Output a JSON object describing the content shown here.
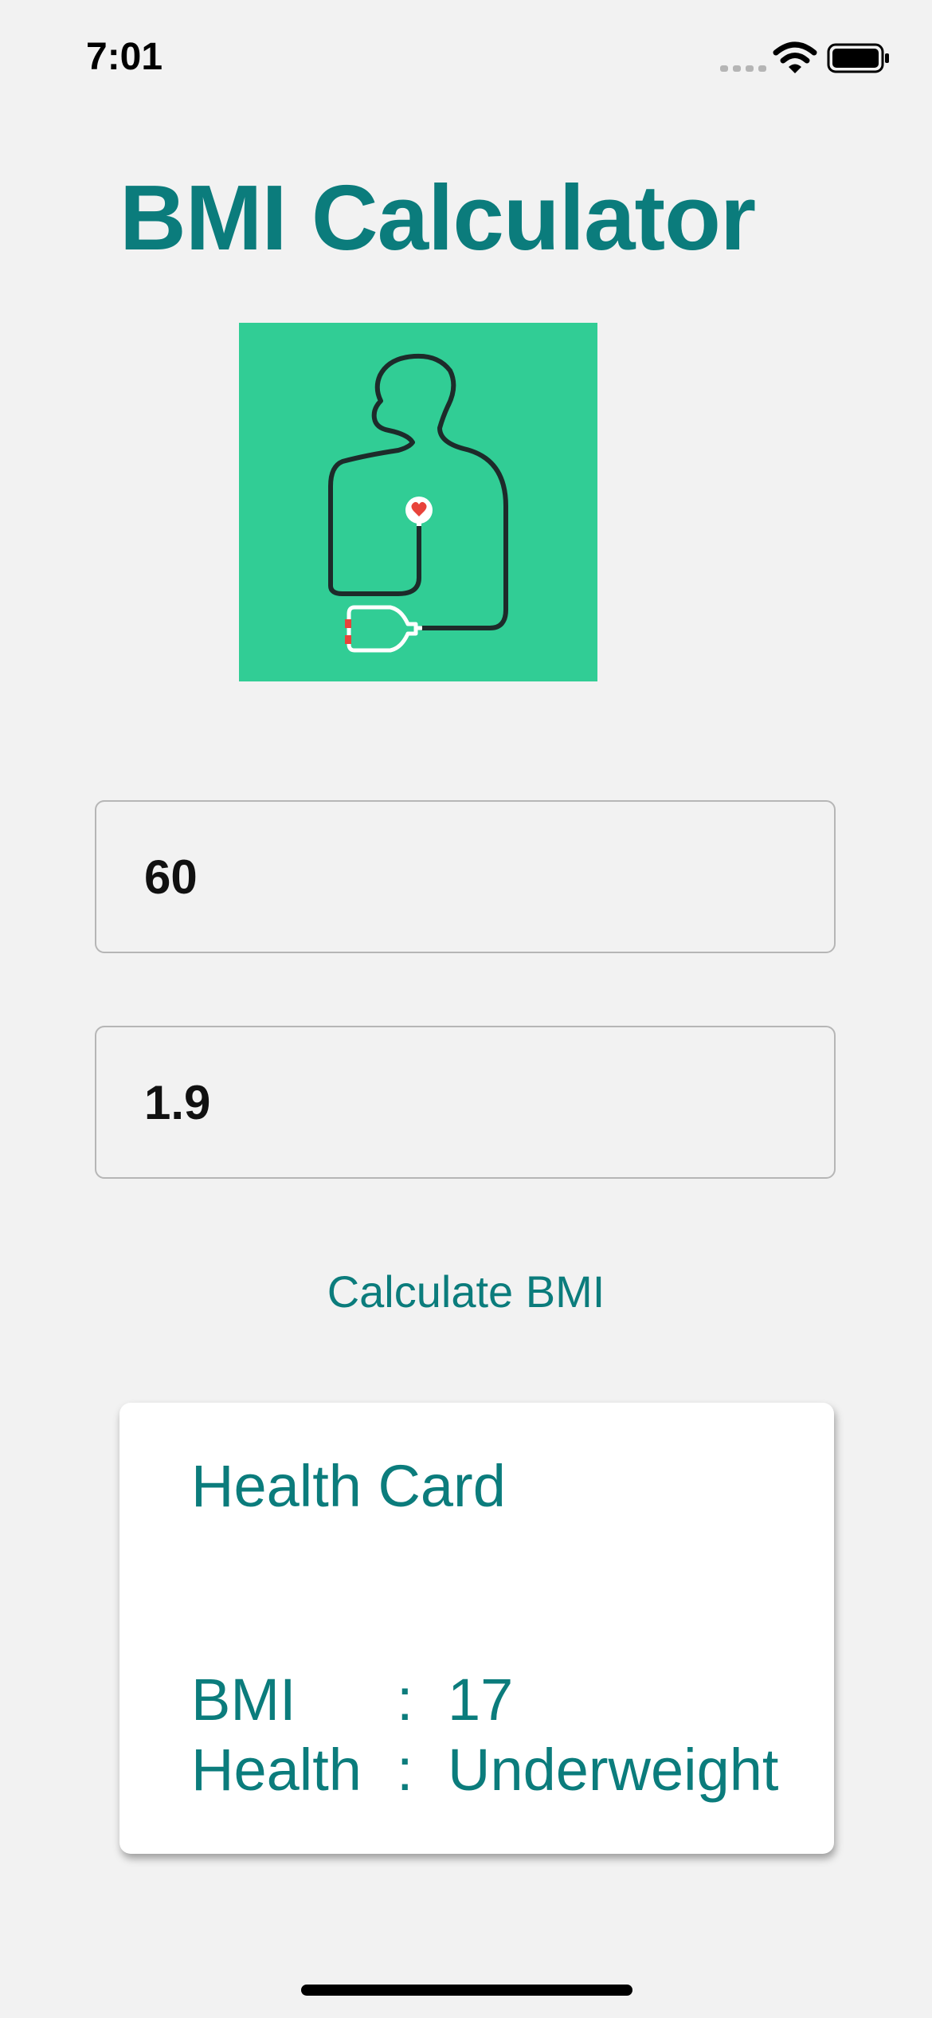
{
  "status_bar": {
    "time": "7:01"
  },
  "app": {
    "title": "BMI Calculator"
  },
  "inputs": {
    "weight_value": "60",
    "height_value": "1.9"
  },
  "actions": {
    "calculate_label": "Calculate BMI"
  },
  "health_card": {
    "title": "Health Card",
    "separator": ":",
    "bmi_label": "BMI",
    "bmi_value": "17",
    "health_label": "Health",
    "health_value": "Underweight"
  },
  "colors": {
    "accent": "#0b7c7c",
    "illustration_bg": "#31cd95",
    "background": "#f2f2f2"
  }
}
